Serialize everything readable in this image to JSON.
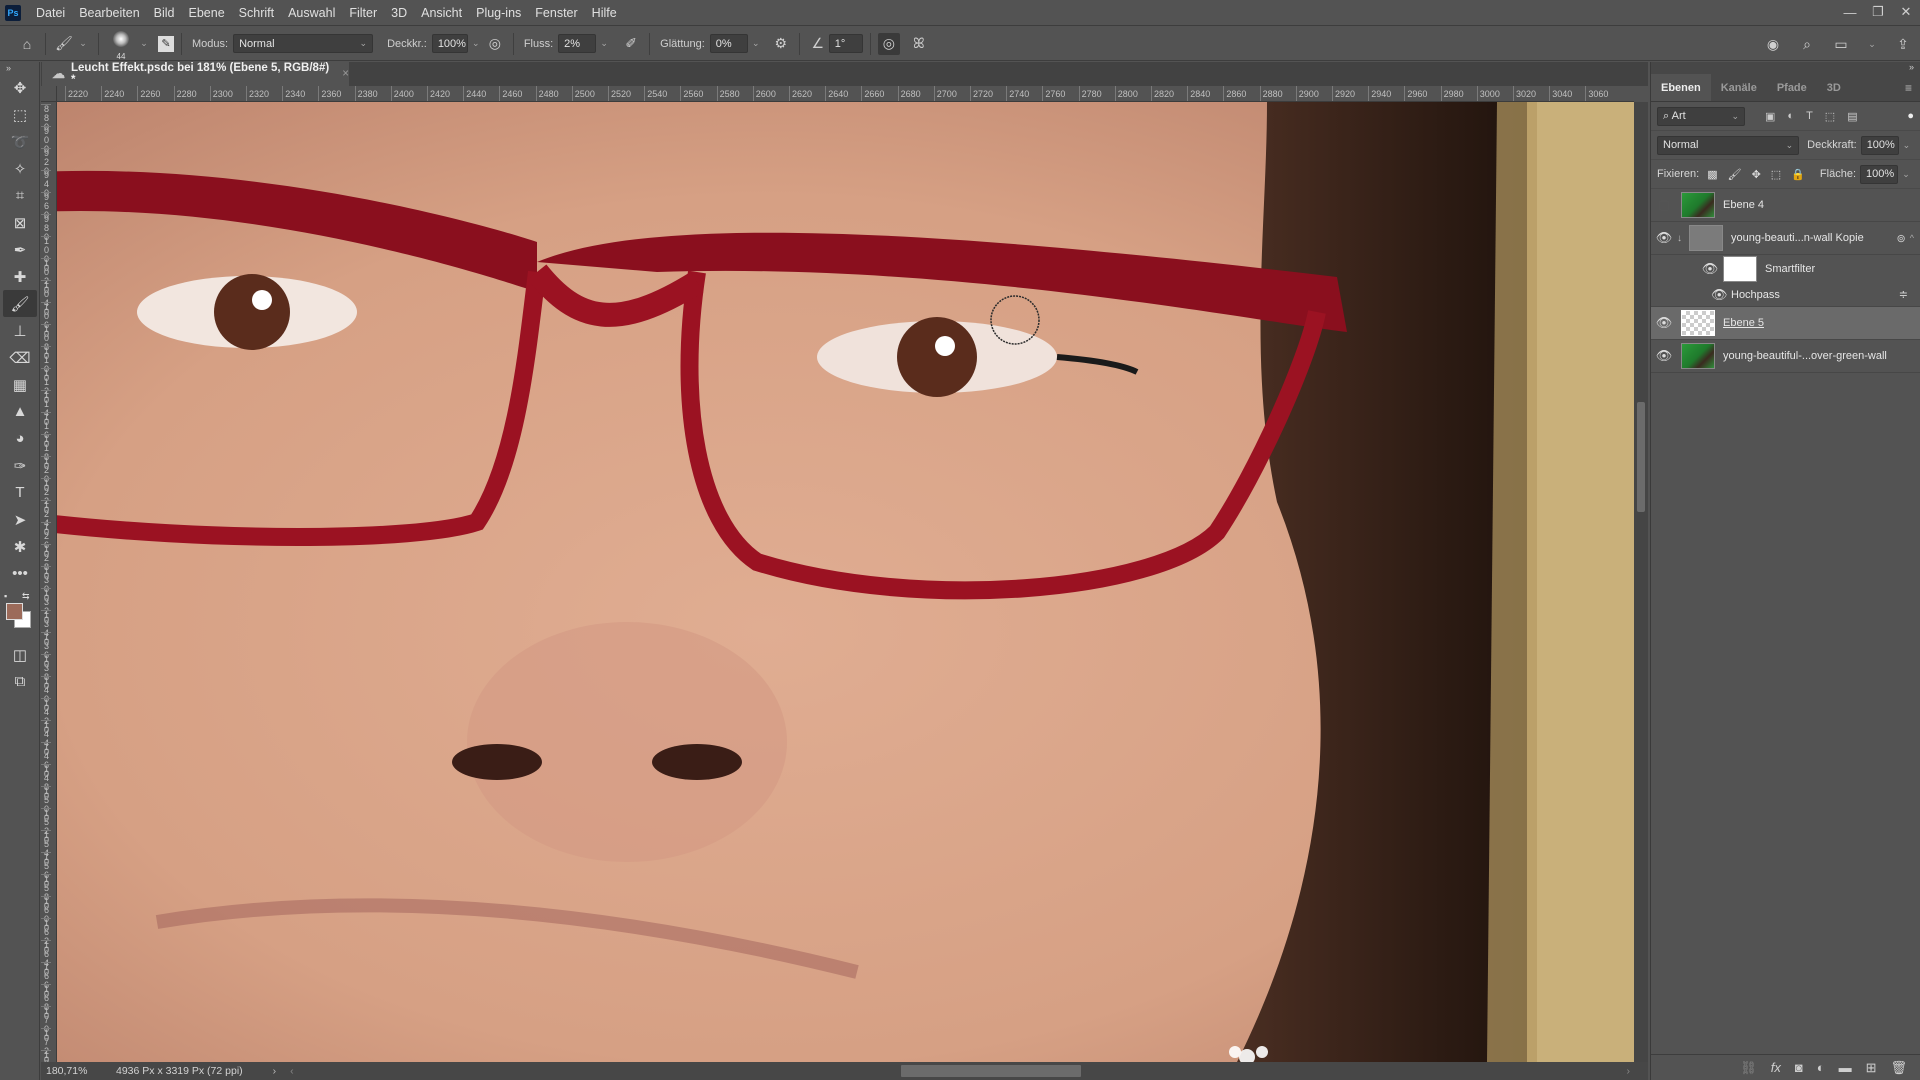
{
  "app": {
    "logo": "Ps"
  },
  "menu": [
    "Datei",
    "Bearbeiten",
    "Bild",
    "Ebene",
    "Schrift",
    "Auswahl",
    "Filter",
    "3D",
    "Ansicht",
    "Plug-ins",
    "Fenster",
    "Hilfe"
  ],
  "window_controls": {
    "minimize": "—",
    "restore": "❐",
    "close": "✕"
  },
  "options": {
    "brush_size": "44",
    "mode_label": "Modus:",
    "mode_value": "Normal",
    "opacity_label": "Deckkr.:",
    "opacity_value": "100%",
    "flow_label": "Fluss:",
    "flow_value": "2%",
    "smoothing_label": "Glättung:",
    "smoothing_value": "0%",
    "angle_value": "1°"
  },
  "document": {
    "tab_title": "Leucht Effekt.psdc bei 181% (Ebene 5, RGB/8#) *",
    "close": "×"
  },
  "ruler_h": [
    "2220",
    "2240",
    "2260",
    "2280",
    "2300",
    "2320",
    "2340",
    "2360",
    "2380",
    "2400",
    "2420",
    "2440",
    "2460",
    "2480",
    "2500",
    "2520",
    "2540",
    "2560",
    "2580",
    "2600",
    "2620",
    "2640",
    "2660",
    "2680",
    "2700",
    "2720",
    "2740",
    "2760",
    "2780",
    "2800",
    "2820",
    "2840",
    "2860",
    "2880",
    "2900",
    "2920",
    "2940",
    "2960",
    "2980",
    "3000",
    "3020",
    "3040",
    "3060"
  ],
  "ruler_v": [
    "880",
    "900",
    "920",
    "940",
    "960",
    "980",
    "1000",
    "1020",
    "1040",
    "1060",
    "1080",
    "1100",
    "1120",
    "1140",
    "1160",
    "1180",
    "1200",
    "1220",
    "1240",
    "1260",
    "1280",
    "1300",
    "1320",
    "1340",
    "1360",
    "1380",
    "1400",
    "1420",
    "1440",
    "1460",
    "1480",
    "1500",
    "1520",
    "1540",
    "1560",
    "1580",
    "1600",
    "1620",
    "1640",
    "1660",
    "1680",
    "1700",
    "1720",
    "1740"
  ],
  "status": {
    "zoom": "180,71%",
    "doc_info": "4936 Px x 3319 Px (72 ppi)"
  },
  "panel": {
    "tabs": [
      "Ebenen",
      "Kanäle",
      "Pfade",
      "3D"
    ],
    "filter_kind": "Art",
    "blend_mode": "Normal",
    "opacity_label": "Deckkraft:",
    "opacity_value": "100%",
    "lock_label": "Fixieren:",
    "fill_label": "Fläche:",
    "fill_value": "100%",
    "layers": [
      {
        "name": "Ebene 4",
        "visible": false
      },
      {
        "name": "young-beauti...n-wall Kopie",
        "visible": true
      },
      {
        "name": "Smartfilter",
        "visible": true
      },
      {
        "name": "Hochpass",
        "visible": true
      },
      {
        "name": "Ebene 5",
        "visible": true,
        "selected": true
      },
      {
        "name": "young-beautiful-...over-green-wall",
        "visible": true
      }
    ]
  },
  "colors": {
    "foreground": "#9c6b5a",
    "background": "#ffffff",
    "accent": "#31a8ff"
  }
}
